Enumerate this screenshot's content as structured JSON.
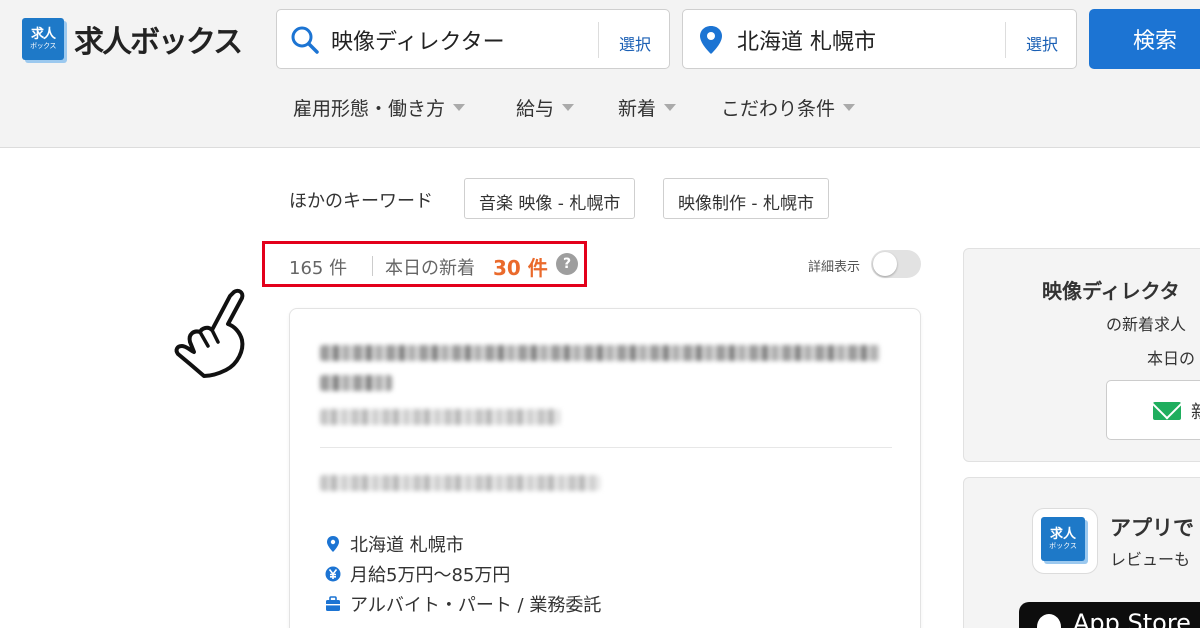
{
  "brand": {
    "logo_mark_line1": "求人",
    "logo_mark_line2": "ボックス",
    "name": "求人ボックス",
    "color": "#1e79c8"
  },
  "search": {
    "keyword_value": "映像ディレクター",
    "keyword_select": "選択",
    "location_value": "北海道 札幌市",
    "location_select": "選択",
    "submit_label": "検索",
    "button_color": "#1c74d3"
  },
  "filters": [
    {
      "label": "雇用形態・働き方"
    },
    {
      "label": "給与"
    },
    {
      "label": "新着"
    },
    {
      "label": "こだわり条件"
    }
  ],
  "other_keywords": {
    "label": "ほかのキーワード",
    "chips": [
      "音楽 映像 - 札幌市",
      "映像制作 - 札幌市"
    ]
  },
  "results": {
    "total": "165 件",
    "new_today_label": "本日の新着",
    "new_today_count": "30 件",
    "help_glyph": "?",
    "detail_view_label": "詳細表示",
    "detail_view_on": false,
    "highlight_color": "#e3001b",
    "new_count_color": "#ea6a2c"
  },
  "job_card": {
    "location": "北海道 札幌市",
    "salary": "月給5万円〜85万円",
    "employment_type": "アルバイト・パート / 業務委託"
  },
  "sidebar": {
    "alert_title": "映像ディレクタ",
    "alert_sub1": "の新着求人",
    "alert_sub2": "本日の",
    "alert_button_label": "新",
    "app_icon_line1": "求人",
    "app_icon_line2": "ボックス",
    "app_title": "アプリで",
    "app_sub": "レビューも",
    "appstore_label": "App Store"
  }
}
